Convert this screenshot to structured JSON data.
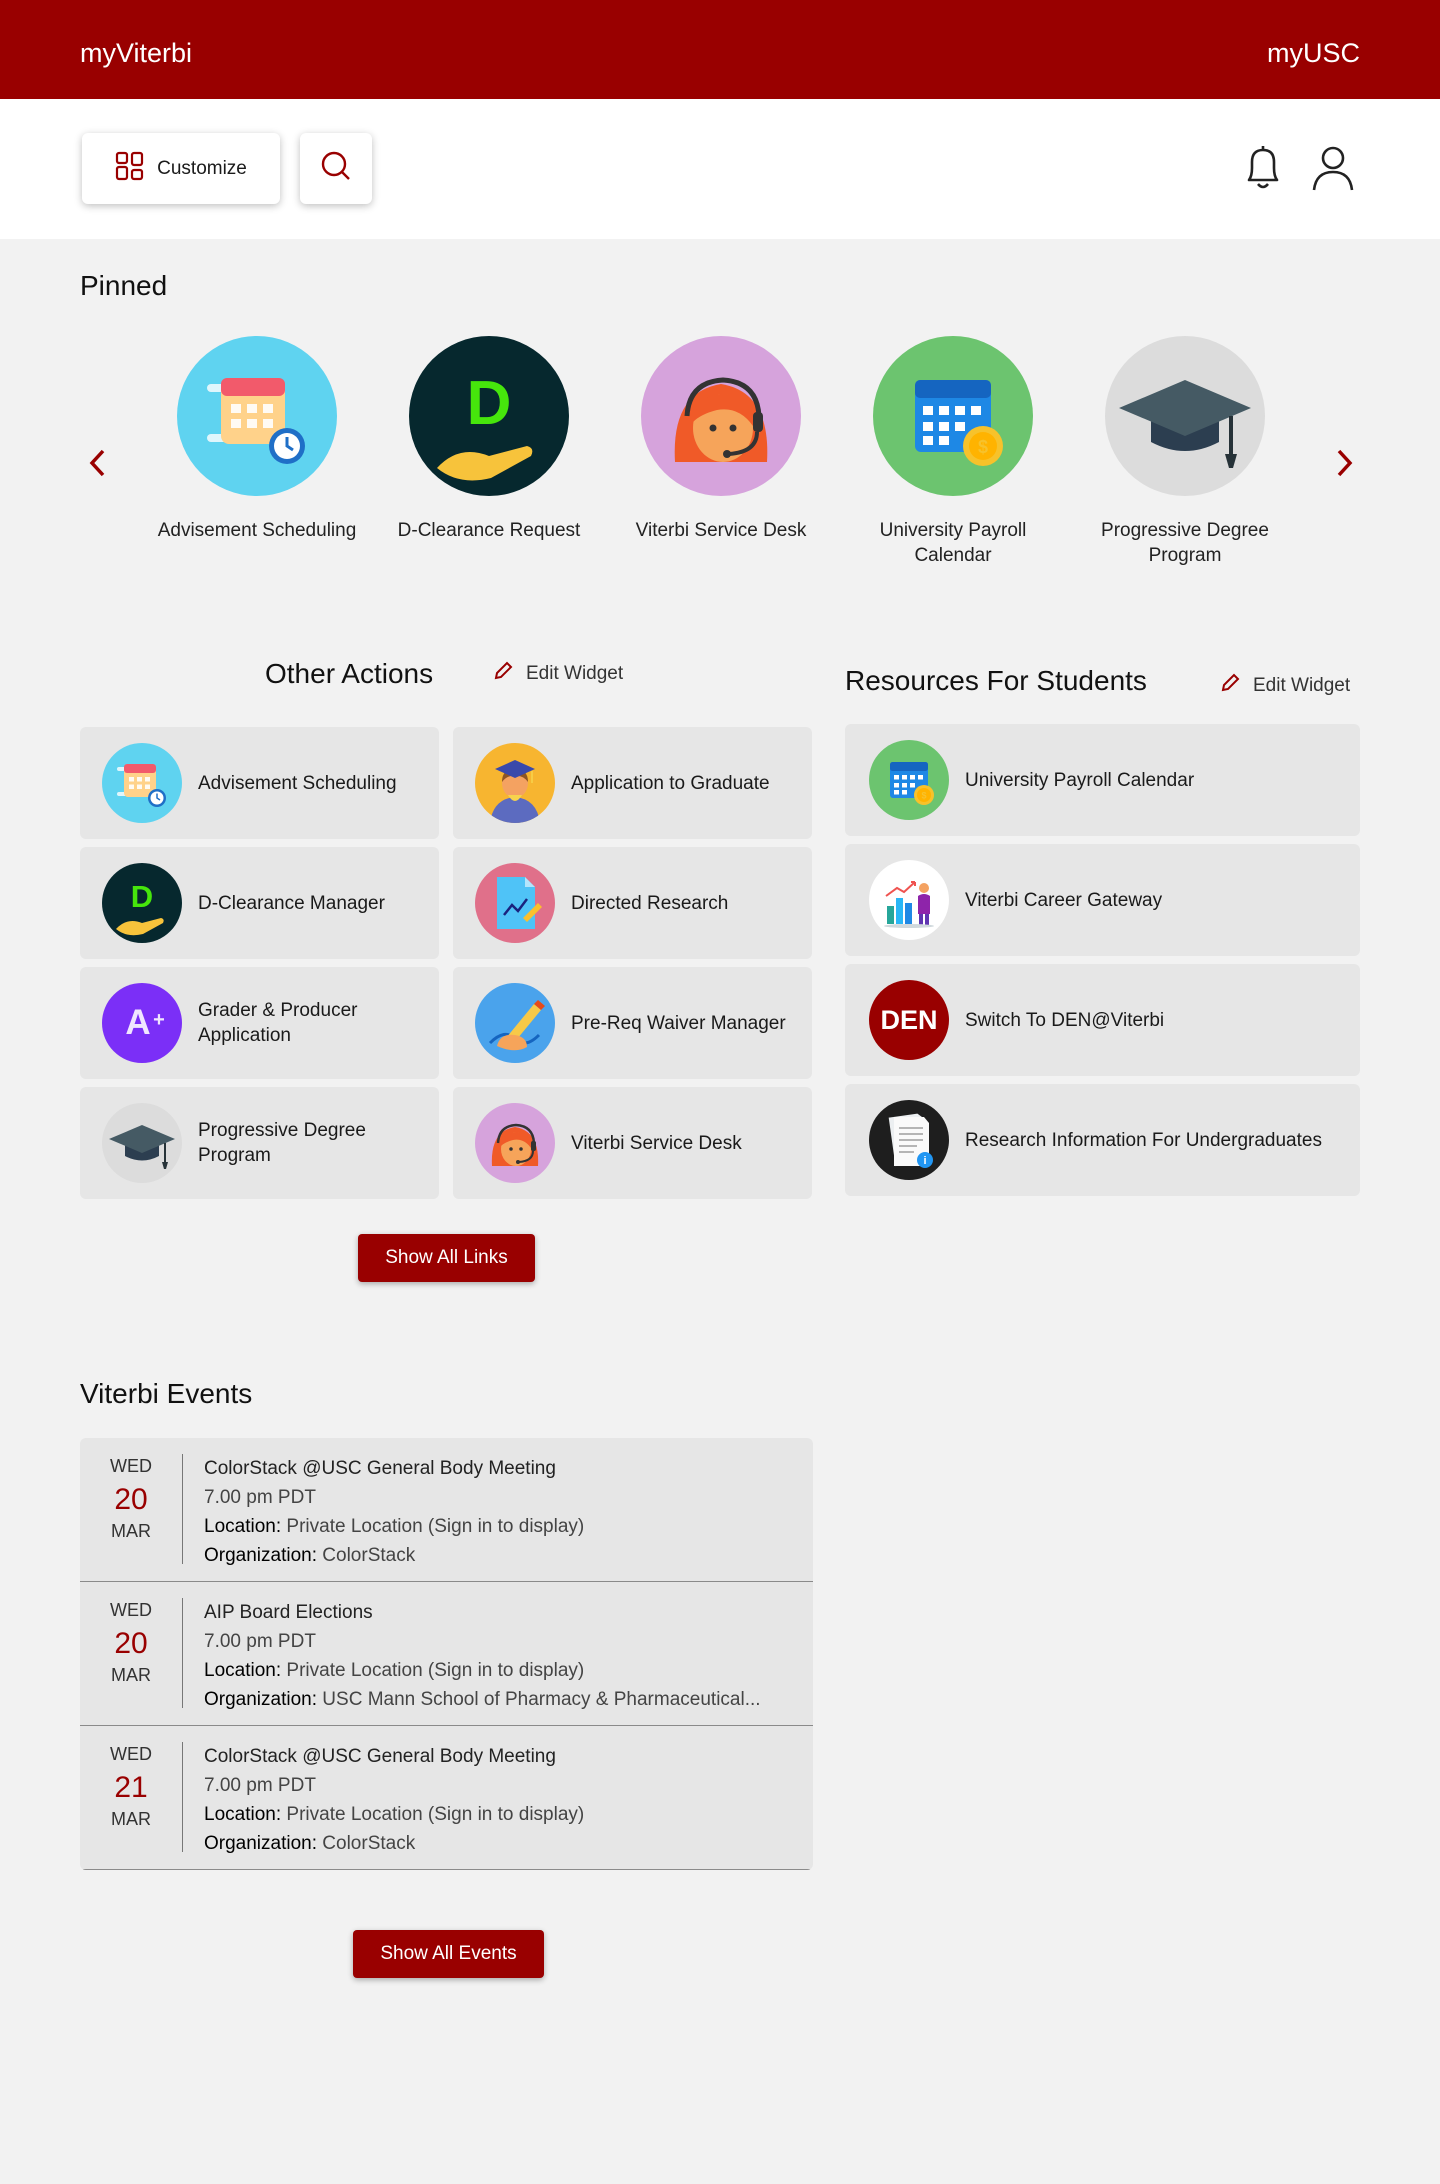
{
  "header": {
    "brand": "myViterbi",
    "right_link": "myUSC"
  },
  "toolbar": {
    "customize_label": "Customize"
  },
  "pinned": {
    "title": "Pinned",
    "items": [
      {
        "label": "Advisement Scheduling",
        "icon": "calendar-clock-icon"
      },
      {
        "label": "D-Clearance Request",
        "icon": "d-clearance-icon"
      },
      {
        "label": "Viterbi Service Desk",
        "icon": "headset-agent-icon"
      },
      {
        "label": "University Payroll Calendar",
        "icon": "payroll-calendar-icon"
      },
      {
        "label": "Progressive Degree Program",
        "icon": "graduation-cap-icon"
      }
    ]
  },
  "other_actions": {
    "title": "Other Actions",
    "edit_label": "Edit Widget",
    "items": [
      {
        "label": "Advisement Scheduling",
        "icon": "calendar-clock-icon"
      },
      {
        "label": "Application to Graduate",
        "icon": "graduate-icon"
      },
      {
        "label": "D-Clearance Manager",
        "icon": "d-clearance-icon"
      },
      {
        "label": "Directed Research",
        "icon": "research-doc-icon"
      },
      {
        "label": "Grader & Producer Application",
        "icon": "a-plus-icon"
      },
      {
        "label": "Pre-Req Waiver Manager",
        "icon": "pen-sign-icon"
      },
      {
        "label": "Progressive Degree Program",
        "icon": "graduation-cap-icon"
      },
      {
        "label": "Viterbi Service Desk",
        "icon": "headset-agent-icon"
      }
    ],
    "show_all_label": "Show All Links"
  },
  "resources": {
    "title": "Resources For Students",
    "edit_label": "Edit Widget",
    "items": [
      {
        "label": "University Payroll Calendar",
        "icon": "payroll-calendar-icon"
      },
      {
        "label": "Viterbi Career Gateway",
        "icon": "career-chart-icon"
      },
      {
        "label": "Switch To DEN@Viterbi",
        "icon": "den-logo-icon",
        "badge": "DEN"
      },
      {
        "label": "Research Information For Undergraduates",
        "icon": "info-document-icon"
      }
    ]
  },
  "events": {
    "title": "Viterbi Events",
    "location_key": "Location:",
    "org_key": "Organization:",
    "items": [
      {
        "dow": "WED",
        "day": "20",
        "mon": "MAR",
        "title": "ColorStack @USC General Body Meeting",
        "time": "7.00 pm PDT",
        "location": "Private Location (Sign in to display)",
        "org": "ColorStack"
      },
      {
        "dow": "WED",
        "day": "20",
        "mon": "MAR",
        "title": "AIP Board Elections",
        "time": "7.00 pm PDT",
        "location": "Private Location (Sign in to display)",
        "org": "USC Mann School of Pharmacy & Pharmaceutical..."
      },
      {
        "dow": "WED",
        "day": "21",
        "mon": "MAR",
        "title": "ColorStack @USC General Body Meeting",
        "time": "7.00 pm PDT",
        "location": "Private Location (Sign in to display)",
        "org": "ColorStack"
      }
    ],
    "show_all_label": "Show All Events"
  },
  "colors": {
    "brand": "#990000",
    "tile": "#e6e6e6",
    "page": "#f2f2f2"
  }
}
